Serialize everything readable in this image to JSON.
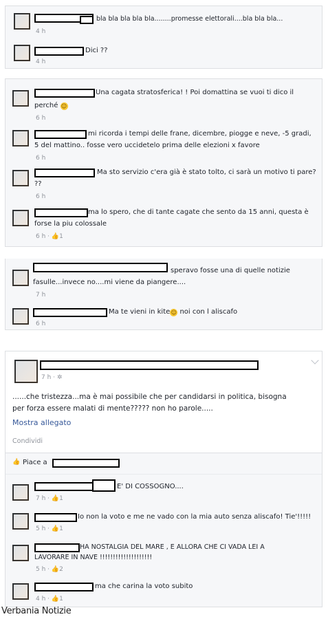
{
  "thread1": {
    "comments": [
      {
        "text": "bla bla bla bla bla........promesse elettorali....bla bla bla...",
        "time": "4 h"
      },
      {
        "text": "Dici ??",
        "time": "4 h"
      }
    ]
  },
  "thread2": {
    "comments": [
      {
        "text1": "Una cagata stratosferica! ! Poi domattina se vuoi ti dico il",
        "text2": "perché",
        "time": "6 h"
      },
      {
        "text1": "mi ricorda i tempi delle frane, dicembre, piogge e neve, -5 gradi,",
        "text2": "5 del mattino.. fosse vero uccidetelo prima delle elezioni x favore",
        "time": "6 h"
      },
      {
        "text1": "Ma sto servizio c'era già è stato tolto, ci sarà un motivo ti pare?",
        "text2": "??",
        "time": "6 h"
      },
      {
        "text1": "ma lo spero, che di tante cagate che sento da 15 anni, questa è",
        "text2": "forse la piu colossale",
        "time": "6 h",
        "likes": "1"
      }
    ]
  },
  "thread3": {
    "comments": [
      {
        "text1": "speravo fosse una di quelle notizie",
        "text2": "fasulle...invece no....mi viene da piangere....",
        "time": "7 h"
      },
      {
        "text1": "Ma te vieni in kite",
        "text2": "noi con l aliscafo",
        "time": "6 h"
      }
    ]
  },
  "post": {
    "time": "7 h",
    "body1": "......che tristezza...ma è mai possibile che per candidarsi in politica, bisogna",
    "body2": "per forza essere malati di mente????? non ho parole.....",
    "show_attachment": "Mostra allegato",
    "share": "Condividi",
    "likes_prefix": "Piace a",
    "comments": [
      {
        "text": "E' DI COSSOGNO....",
        "time": "7 h",
        "likes": "1"
      },
      {
        "text": "Io non la voto e me ne vado con la mia auto senza aliscafo! Tie'!!!!!",
        "time": "5 h",
        "likes": "1"
      },
      {
        "text1": "HA NOSTALGIA DEL MARE , E ALLORA CHE CI VADA LEI A",
        "text2": "LAVORARE IN NAVE !!!!!!!!!!!!!!!!!!!!",
        "time": "5 h",
        "likes": "2"
      },
      {
        "text": "ma che carina la voto subito",
        "time": "4 h",
        "likes": "1"
      }
    ]
  },
  "credit": "Verbania Notizie",
  "icons": {
    "like": "thumbs-up-icon",
    "globe": "globe-icon",
    "emoji": "smiley-icon",
    "chevron": "chevron-down-icon"
  }
}
